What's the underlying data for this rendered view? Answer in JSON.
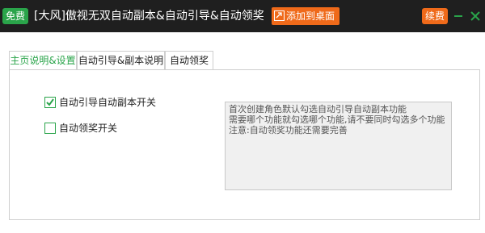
{
  "titlebar": {
    "free_badge": "免费",
    "title": "[大风]傲视无双自动副本&自动引导&自动领奖",
    "add_desktop": "添加到桌面",
    "renew": "续费"
  },
  "tabs": [
    {
      "label": "主页说明&设置",
      "active": true
    },
    {
      "label": "自动引导&副本说明",
      "active": false
    },
    {
      "label": "自动领奖",
      "active": false
    }
  ],
  "settings": {
    "auto_guide_dungeon": {
      "label": "自动引导自动副本开关",
      "checked": true
    },
    "auto_reward": {
      "label": "自动领奖开关",
      "checked": false
    }
  },
  "info": {
    "lines": [
      "首次创建角色默认勾选自动引导自动副本功能",
      "需要哪个功能就勾选哪个功能,请不要同时勾选多个功能",
      "注意:自动领奖功能还需要完善"
    ]
  },
  "colors": {
    "titlebar_bg": "#1f1f1f",
    "accent_green": "#2aa44a",
    "accent_orange": "#ef6a1a"
  }
}
